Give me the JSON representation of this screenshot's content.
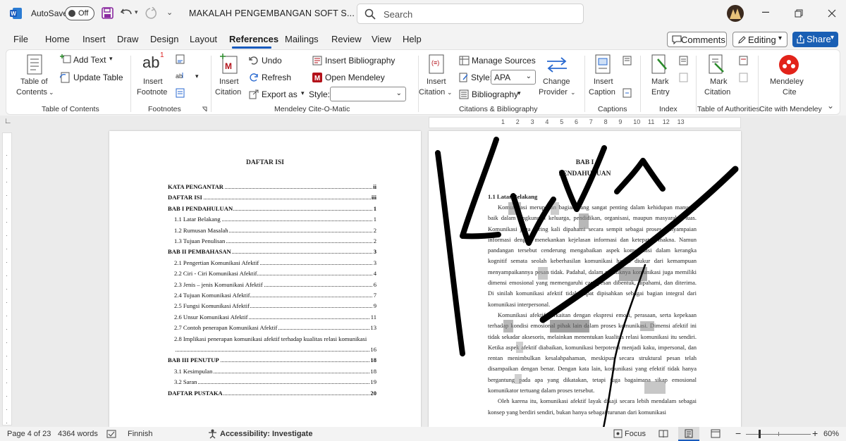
{
  "titlebar": {
    "autosave_label": "AutoSave",
    "autosave_state": "Off",
    "doc_title": "MAKALAH PENGEMBANGAN SOFT S...",
    "search_placeholder": "Search"
  },
  "menu": {
    "items": [
      "File",
      "Home",
      "Insert",
      "Draw",
      "Design",
      "Layout",
      "References",
      "Mailings",
      "Review",
      "View",
      "Help"
    ],
    "active": "References",
    "comments": "Comments",
    "editing": "Editing",
    "share": "Share"
  },
  "ribbon": {
    "toc": {
      "btn_line1": "Table of",
      "btn_line2": "Contents",
      "add_text": "Add Text",
      "update_table": "Update Table",
      "group": "Table of Contents"
    },
    "footnotes": {
      "btn_line1": "Insert",
      "btn_line2": "Footnote",
      "ab": "ab",
      "sup": "1",
      "group": "Footnotes"
    },
    "mendeley_cite": {
      "insert_line1": "Insert",
      "insert_line2": "Citation",
      "undo": "Undo",
      "refresh": "Refresh",
      "export_as": "Export as",
      "insert_bibliography": "Insert Bibliography",
      "open_mendeley": "Open Mendeley",
      "style_label": "Style:",
      "style_value": "",
      "group": "Mendeley Cite-O-Matic"
    },
    "citations": {
      "insert_line1": "Insert",
      "insert_line2": "Citation",
      "manage_sources": "Manage Sources",
      "style_label": "Style:",
      "style_value": "APA",
      "bibliography": "Bibliography",
      "change_line1": "Change",
      "change_line2": "Provider",
      "group": "Citations & Bibliography"
    },
    "captions": {
      "btn_line1": "Insert",
      "btn_line2": "Caption",
      "group": "Captions"
    },
    "index": {
      "btn_line1": "Mark",
      "btn_line2": "Entry",
      "group": "Index"
    },
    "authorities": {
      "btn_line1": "Mark",
      "btn_line2": "Citation",
      "group": "Table of Authorities"
    },
    "mendeley": {
      "btn_line1": "Mendeley",
      "btn_line2": "Cite",
      "group": "Cite with Mendeley"
    }
  },
  "ruler": {
    "ticks": [
      "1",
      "2",
      "3",
      "4",
      "5",
      "6",
      "7",
      "8",
      "9",
      "10",
      "11",
      "12",
      "13"
    ]
  },
  "page1": {
    "heading": "DAFTAR ISI",
    "entries": [
      {
        "text": "KATA PENGANTAR",
        "page": "ii",
        "bold": true,
        "indent": 0
      },
      {
        "text": "DAFTAR ISI",
        "page": "iii",
        "bold": true,
        "indent": 0
      },
      {
        "text": "BAB I  PENDAHULUAN",
        "page": "1",
        "bold": true,
        "indent": 0
      },
      {
        "text": "1.1 Latar Belakang",
        "page": "1",
        "bold": false,
        "indent": 1
      },
      {
        "text": "1.2 Rumusan Masalah",
        "page": "2",
        "bold": false,
        "indent": 1
      },
      {
        "text": "1.3 Tujuan Penulisan",
        "page": "2",
        "bold": false,
        "indent": 1
      },
      {
        "text": "BAB II PEMBAHASAN",
        "page": "3",
        "bold": true,
        "indent": 0
      },
      {
        "text": "2.1 Pengertian Komunikasi Afektif",
        "page": "3",
        "bold": false,
        "indent": 1
      },
      {
        "text": "2.2  Ciri - Ciri Komunikasi Afektif",
        "page": "4",
        "bold": false,
        "indent": 1
      },
      {
        "text": "2.3 Jenis – jenis Komunikasi Afektif",
        "page": "6",
        "bold": false,
        "indent": 1
      },
      {
        "text": "2.4 Tujuan Komunikasi Afektif",
        "page": "7",
        "bold": false,
        "indent": 1
      },
      {
        "text": "2.5 Fungsi Komunikasi Afektif",
        "page": "9",
        "bold": false,
        "indent": 1
      },
      {
        "text": "2.6 Unsur Komunikasi Afektif",
        "page": "11",
        "bold": false,
        "indent": 1
      },
      {
        "text": "2.7 Contoh penerapan Komunikasi Afektif",
        "page": "13",
        "bold": false,
        "indent": 1
      },
      {
        "text": "2.8 Implikasi penerapan komunikasi afektif terhadap kualitas relasi komunikasi",
        "page": "",
        "bold": false,
        "indent": 1
      },
      {
        "text": "",
        "page": "16",
        "bold": false,
        "indent": 1
      },
      {
        "text": "BAB III PENUTUP",
        "page": "18",
        "bold": true,
        "indent": 0
      },
      {
        "text": "3.1 Kesimpulan",
        "page": "18",
        "bold": false,
        "indent": 1
      },
      {
        "text": "3.2 Saran",
        "page": "19",
        "bold": false,
        "indent": 1
      },
      {
        "text": "DAFTAR PUSTAKA",
        "page": "20",
        "bold": true,
        "indent": 0
      }
    ]
  },
  "page2": {
    "chapter": "BAB I",
    "chapter_title": "PENDAHULUAN",
    "section": "1.1 Latar Belakang",
    "para1": "Komunikasi merupakan bagian yang sangat penting dalam kehidupan manusia, baik dalam lingkungan keluarga, pendidikan, organisasi, maupun masyarakat luas. Komunikasi juga sering kali dipahami secara sempit sebagai proses penyampaian informasi dengan menekankan kejelasan informasi dan ketepatan makna. Namun pandangan tersebut cenderung mengabaikan aspek komunikasi dalam kerangka kognitif semata seolah keberhasilan komunikasi hanya diukur dari kemampuan menyampaikannya pesan tidak. Padahal, dalam praktiknya komunikasi juga memiliki dimensi emosional yang memengaruhi cara pesan dibentuk, dipahami, dan diterima. Di sinilah komunikasi afektif tidak dapat dipisahkan sebagai bagian integral dari komunikasi interpersonal.",
    "para2": "Komunikasi afektif berkaitan dengan ekspresi emosi, perasaan, serta kepekaan terhadap kondisi emosional pihak lain dalam proses komunikasi. Dimensi afektif ini tidak sekadar aksesoris, melainkan menentukan kualitas relasi komunikasi itu sendiri. Ketika aspek afektif diabaikan, komunikasi berpotensi menjadi kaku, impersonal, dan rentan menimbulkan kesalahpahaman, meskipun secara struktural pesan telah disampaikan dengan benar. Dengan kata lain, komunikasi yang efektif tidak hanya bergantung pada apa yang dikatakan, tetapi juga bagaimana sikap emosional komunikator tertuang dalam proses tersebut.",
    "para3": "Oleh karena itu, komunikasi afektif layak dikaji secara lebih mendalam sebagai konsep yang berdiri sendiri, bukan hanya sebagai turunan dari komunikasi"
  },
  "status": {
    "page": "Page 4 of 23",
    "words": "4364 words",
    "language": "Finnish",
    "accessibility": "Accessibility: Investigate",
    "focus": "Focus",
    "zoom": "60%"
  },
  "colors": {
    "accent": "#185abd",
    "share_bg": "#1a5fb4",
    "mendeley_red": "#e2231a",
    "ink": "#000000"
  }
}
